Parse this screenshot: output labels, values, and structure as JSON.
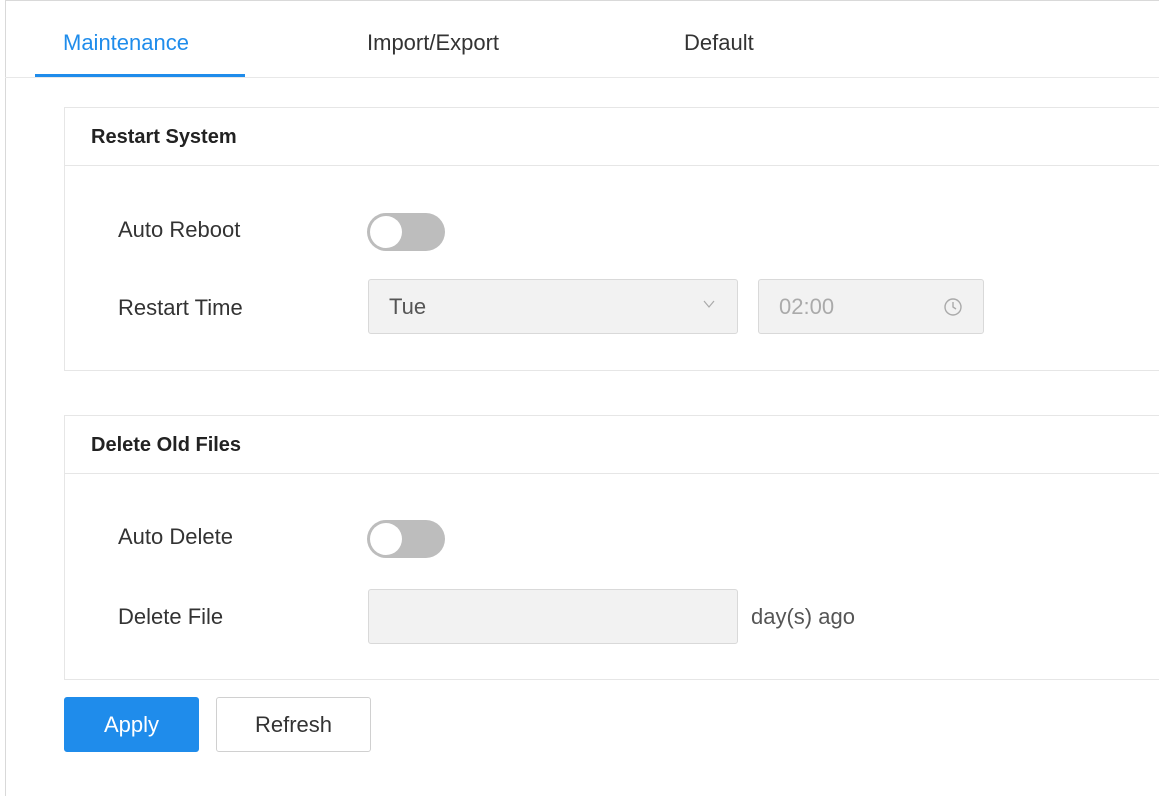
{
  "tabs": [
    {
      "label": "Maintenance",
      "active": true
    },
    {
      "label": "Import/Export",
      "active": false
    },
    {
      "label": "Default",
      "active": false
    }
  ],
  "restart_system": {
    "title": "Restart System",
    "auto_reboot_label": "Auto Reboot",
    "auto_reboot_enabled": false,
    "restart_time_label": "Restart Time",
    "restart_day": "Tue",
    "restart_time": "02:00"
  },
  "delete_old_files": {
    "title": "Delete Old Files",
    "auto_delete_label": "Auto Delete",
    "auto_delete_enabled": false,
    "delete_file_label": "Delete File",
    "delete_file_value": "",
    "delete_file_suffix": "day(s) ago"
  },
  "buttons": {
    "apply": "Apply",
    "refresh": "Refresh"
  },
  "colors": {
    "accent": "#1f8ceb",
    "toggle_off": "#bdbdbd",
    "disabled_field": "#f2f2f2"
  },
  "icons": {
    "dropdown": "chevron-down-icon",
    "time": "clock-icon"
  }
}
